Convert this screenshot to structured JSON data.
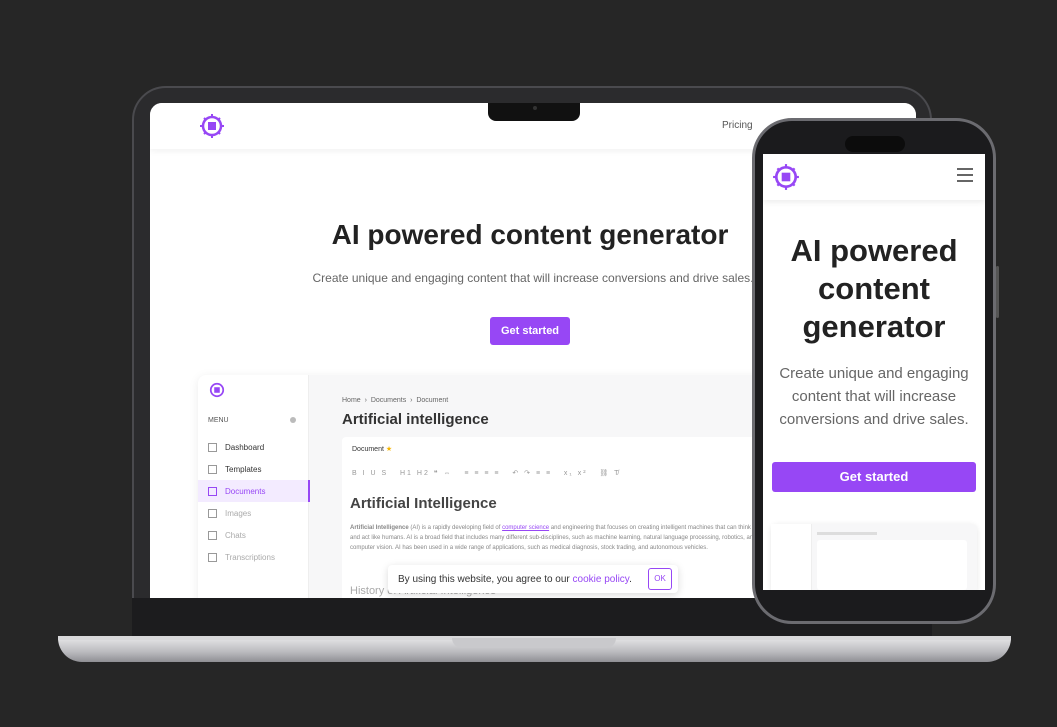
{
  "colors": {
    "accent": "#9747f5",
    "background": "#262626"
  },
  "site": {
    "logo_icon": "chip-icon",
    "nav_pricing": "Pricing",
    "hero_title": "AI powered content generator",
    "hero_subtitle": "Create unique and engaging content that will increase conversions and drive sales.",
    "cta": "Get started"
  },
  "app_preview": {
    "menu_label": "MENU",
    "sidebar_items": [
      "Dashboard",
      "Templates",
      "Documents",
      "Images",
      "Chats",
      "Transcriptions"
    ],
    "active_item": "Documents",
    "breadcrumb": [
      "Home",
      "Documents",
      "Document"
    ],
    "page_title": "Artificial intelligence",
    "doc_label": "Document",
    "doc_heading": "Artificial Intelligence",
    "doc_paragraph_bold": "Artificial Intelligence",
    "doc_paragraph_a": " (AI) is a rapidly developing field of ",
    "doc_paragraph_link": "computer science",
    "doc_paragraph_b": " and engineering that focuses on creating intelligent machines that can think and act like humans. AI is a broad field that includes many different sub-disciplines, such as machine learning, natural language processing, robotics, and computer vision. AI has been used in a wide range of applications, such as medical diagnosis, stock trading, and autonomous vehicles.",
    "doc_subheading": "History of Artificial Intelligence"
  },
  "cookie_banner": {
    "text": "By using this website, you agree to our ",
    "link": "cookie policy",
    "period": ".",
    "ok": "OK"
  },
  "phone": {
    "hero_title": "AI powered content generator",
    "hero_subtitle": "Create unique and engaging content that will increase conversions and drive sales.",
    "cta": "Get started",
    "menu_icon": "hamburger-icon"
  }
}
